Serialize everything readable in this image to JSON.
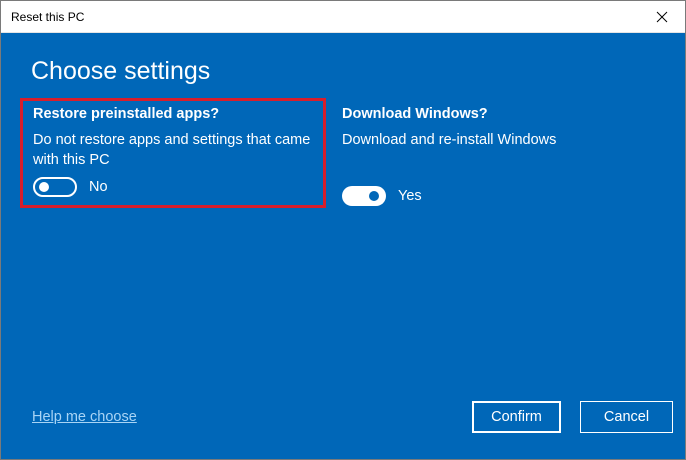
{
  "window": {
    "title": "Reset this PC",
    "close_icon": "close-icon"
  },
  "page": {
    "heading": "Choose settings"
  },
  "restore_apps": {
    "title": "Restore preinstalled apps?",
    "description": "Do not restore apps and settings that came with this PC",
    "toggle_state": "off",
    "toggle_label": "No",
    "highlight_color": "#d81e2c"
  },
  "download_windows": {
    "title": "Download Windows?",
    "description": "Download and re-install Windows",
    "toggle_state": "on",
    "toggle_label": "Yes"
  },
  "footer": {
    "help_link": "Help me choose",
    "confirm_label": "Confirm",
    "cancel_label": "Cancel"
  },
  "colors": {
    "background": "#0067b8",
    "text": "#ffffff",
    "link": "#a8d4f5"
  }
}
